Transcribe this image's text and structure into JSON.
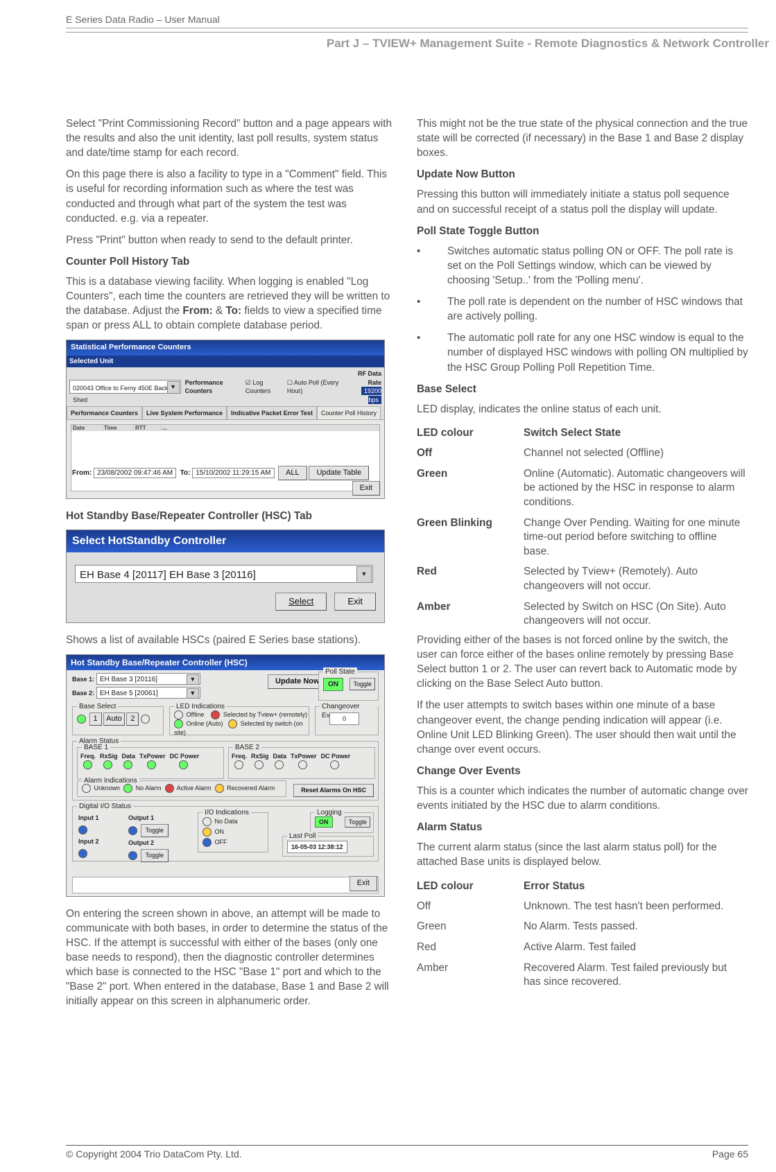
{
  "header": {
    "breadcrumb": "E Series Data Radio – User Manual",
    "section": "Part J – TVIEW+ Management Suite -  Remote Diagnostics & Network Controller"
  },
  "left": {
    "p1": "Select \"Print Commissioning Record\" button and a page appears with the results and also the unit identity, last poll results, system status and date/time stamp for each record.",
    "p2": "On this page there is also a facility to type in a \"Comment\" field. This is useful for recording information such as where the test was conducted and through what part of the system the test was conducted. e.g. via a repeater.",
    "p3": "Press \"Print\" button when ready to send to the default printer.",
    "h1": "Counter Poll History Tab",
    "p4a": "This is a database viewing facility.  When logging is enabled \"Log Counters\", each time the counters are retrieved they will be written to the database.  Adjust the ",
    "p4b": "From:",
    "p4c": " & ",
    "p4d": "To:",
    "p4e": " fields to view a specified time span or press ALL to obtain complete database period.",
    "h2": "Hot Standby Base/Repeater Controller (HSC) Tab",
    "p5": "Shows a list of available HSCs (paired E Series base stations).",
    "p6": "On entering the screen shown in above, an attempt will be made to communicate with both bases, in order to determine the status of the HSC. If the attempt is successful with either of the bases (only one base needs to respond), then the diagnostic controller determines which base is connected to the HSC \"Base 1\" port and which to the \"Base 2\" port.  When entered in the database, Base 1 and Base 2 will initially appear on this screen in alphanumeric order."
  },
  "right": {
    "p1": " This might not be the true state of the physical connection and the true state will be corrected (if necessary) in the Base 1 and  Base 2 display boxes.",
    "h1": "Update Now Button",
    "p2": "Pressing this button will immediately initiate a status poll sequence and on successful receipt of a status poll the display will update.",
    "h2": "Poll State Toggle Button",
    "b1": "Switches automatic status polling ON or OFF.  The poll rate is set on the Poll Settings window, which can be viewed by choosing 'Setup..'  from the 'Polling menu'.",
    "b2": "The poll rate is dependent on the number of HSC windows that are actively polling.",
    "b3": "The automatic poll rate for any one HSC window is equal to the number of displayed HSC windows with polling ON multiplied by the HSC Group Polling Poll Repetition Time.",
    "h3": "Base Select",
    "p3": "LED display, indicates the online status of each unit.",
    "tbl1": {
      "hA": "LED colour",
      "hB": "Switch Select State",
      "rows": [
        {
          "a": "Off",
          "b": "Channel not selected (Offline)"
        },
        {
          "a": "Green",
          "b": "Online (Automatic).  Automatic changeovers will be actioned by the HSC in response to alarm conditions."
        },
        {
          "a": "Green Blinking",
          "b": "Change Over Pending. Waiting for one minute time-out period before switching to offline base."
        },
        {
          "a": "Red",
          "b": "Selected by Tview+ (Remotely).  Auto changeovers will not occur."
        },
        {
          "a": "Amber",
          "b": "Selected by Switch on HSC (On Site).  Auto changeovers will not occur."
        }
      ]
    },
    "p4": "Providing either of the bases is not forced online by the switch, the user can force either of the bases online remotely by pressing Base Select button 1 or 2.  The user can revert back to Automatic mode by clicking on the Base Select Auto button.",
    "p5": "If the user attempts to switch bases within one minute of a base changeover event, the change pending indication will appear (i.e. Online Unit LED Blinking Green).  The user should then wait until the change over event occurs.",
    "h4": "Change Over Events",
    "p6": "This is a counter which indicates the number of automatic change over events initiated by the HSC due to alarm conditions.",
    "h5": "Alarm Status",
    "p7": "The current alarm status (since the last alarm status poll) for the attached Base units is displayed below.",
    "tbl2": {
      "hA": "LED colour",
      "hB": "Error Status",
      "rows": [
        {
          "a": "Off",
          "b": "Unknown. The test hasn't been performed."
        },
        {
          "a": "Green",
          "b": "No Alarm.   Tests passed."
        },
        {
          "a": "Red",
          "b": "Active Alarm.   Test failed"
        },
        {
          "a": "Amber",
          "b": "Recovered Alarm.  Test failed previously but has since recovered."
        }
      ]
    }
  },
  "ss1": {
    "title": "Statistical Performance Counters",
    "selunit_lbl": "Selected Unit",
    "selunit_val": "020043 Office to Ferny 450E Back Shed",
    "perfc_lbl": "Performance Counters",
    "logc": "Log Counters",
    "autopoll": "Auto Poll  (Every Hour)",
    "rfrate_lbl": "RF Data Rate",
    "rfrate_val": "19200 bps",
    "tabs": [
      "Performance Counters",
      "Live System Performance",
      "Indicative Packet Error Test",
      "Counter Poll History"
    ],
    "from_lbl": "From:",
    "from_val": "23/08/2002 09:47:46 AM",
    "to_lbl": "To:",
    "to_val": "15/10/2002 11:29:15 AM",
    "all": "ALL",
    "update": "Update Table",
    "exit": "Exit"
  },
  "ss2": {
    "title": "Select HotStandby Controller",
    "field": "EH Base 4 [20117]  EH Base 3 [20116]",
    "select": "Select",
    "exit": "Exit"
  },
  "ss3": {
    "title": "Hot Standby Base/Repeater Controller (HSC)",
    "b1_lbl": "Base 1:",
    "b1_val": "EH Base 3 [20116]",
    "b2_lbl": "Base 2:",
    "b2_val": "EH Base 5 [20061]",
    "upd": "Update Now",
    "ps_lbl": "Poll State",
    "ps_val": "ON",
    "toggle": "Toggle",
    "bs_lbl": "Base Select",
    "auto": "Auto",
    "li_lbl": "LED Indications",
    "li_off": "Offline",
    "li_on": "Online (Auto)",
    "li_rem": "Selected by Tview+ (remotely)",
    "li_sw": "Selected by switch (on site)",
    "coe_lbl": "Changeover Events",
    "coe_val": "0",
    "as_lbl": "Alarm Status",
    "b1": "BASE 1",
    "b2": "BASE 2",
    "cols": [
      "Freq.",
      "RxSig",
      "Data",
      "TxPower",
      "DC Power"
    ],
    "ai_lbl": "Alarm Indications",
    "ai_unk": "Unknown",
    "ai_no": "No Alarm",
    "ai_act": "Active Alarm",
    "ai_rec": "Recovered Alarm",
    "reset": "Reset Alarms On HSC",
    "dio_lbl": "Digital I/O Status",
    "in1": "Input 1",
    "in2": "Input 2",
    "out1": "Output 1",
    "out2": "Output 2",
    "io_lbl": "I/O Indications",
    "io_nd": "No Data",
    "io_on": "ON",
    "io_off": "OFF",
    "log_lbl": "Logging",
    "log_val": "ON",
    "lp_lbl": "Last Poll",
    "lp_val": "16-05-03  12:38:12",
    "exit": "Exit"
  },
  "footer": {
    "copy": "© Copyright 2004 Trio DataCom Pty. Ltd.",
    "page": "Page 65"
  }
}
